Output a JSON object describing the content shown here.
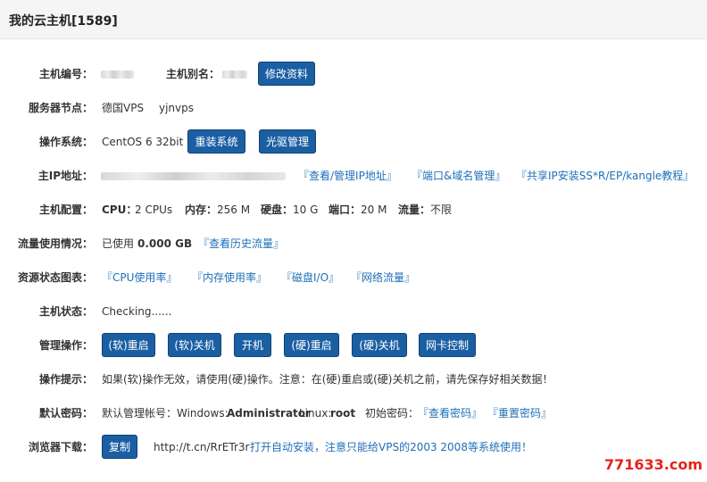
{
  "header": {
    "title": "我的云主机[1589]"
  },
  "host_id": {
    "label": "主机编号："
  },
  "host_alias": {
    "label": "主机别名："
  },
  "edit_button": "修改资料",
  "server_node": {
    "label": "服务器节点：",
    "node": "德国VPS",
    "code": "yjnvps"
  },
  "os": {
    "label": "操作系统：",
    "value": "CentOS 6 32bit",
    "reinstall": "重装系统",
    "cdrom": "光驱管理"
  },
  "main_ip": {
    "label": "主IP地址：",
    "links": [
      "『查看/管理IP地址』",
      "『端口&域名管理』",
      "『共享IP安装SS*R/EP/kangle教程』"
    ]
  },
  "config": {
    "label": "主机配置：",
    "cpu_label": "CPU：",
    "cpu_value": "2 CPUs",
    "mem_label": "内存：",
    "mem_value": "256 M",
    "disk_label": "硬盘：",
    "disk_value": "10 G",
    "port_label": "端口：",
    "port_value": "20 M",
    "traffic_label": "流量：",
    "traffic_value": "不限"
  },
  "traffic": {
    "label": "流量使用情况：",
    "prefix": "已使用",
    "amount": "0.000 GB",
    "history_link": "『查看历史流量』"
  },
  "resource": {
    "label": "资源状态图表：",
    "links": [
      "『CPU使用率』",
      "『内存使用率』",
      "『磁盘I/O』",
      "『网络流量』"
    ]
  },
  "status": {
    "label": "主机状态：",
    "value": "Checking......"
  },
  "manage": {
    "label": "管理操作：",
    "buttons": [
      "(软)重启",
      "(软)关机",
      "开机",
      "(硬)重启",
      "(硬)关机",
      "网卡控制"
    ]
  },
  "tip": {
    "label": "操作提示：",
    "text": "如果(软)操作无效，请使用(硬)操作。注意：在(硬)重启或(硬)关机之前，请先保存好相关数据！"
  },
  "password": {
    "label": "默认密码：",
    "account_prefix": "默认管理帐号：Windows:",
    "windows_user": "Administrator",
    "linux_prefix": "Linux:",
    "linux_user": "root",
    "initial_label": "初始密码：",
    "view_link": "『查看密码』",
    "reset_link": "『重置密码』"
  },
  "browser": {
    "label": "浏览器下载：",
    "copy_button": "复制",
    "url": "http://t.cn/RrETr3r",
    "hint": "打开自动安装，注意只能给VPS的2003 2008等系统使用！"
  },
  "watermark": "771633.com",
  "colors": {
    "button_bg": "#1b5fa3",
    "link": "#1e6fb8",
    "watermark": "#e1251b"
  }
}
